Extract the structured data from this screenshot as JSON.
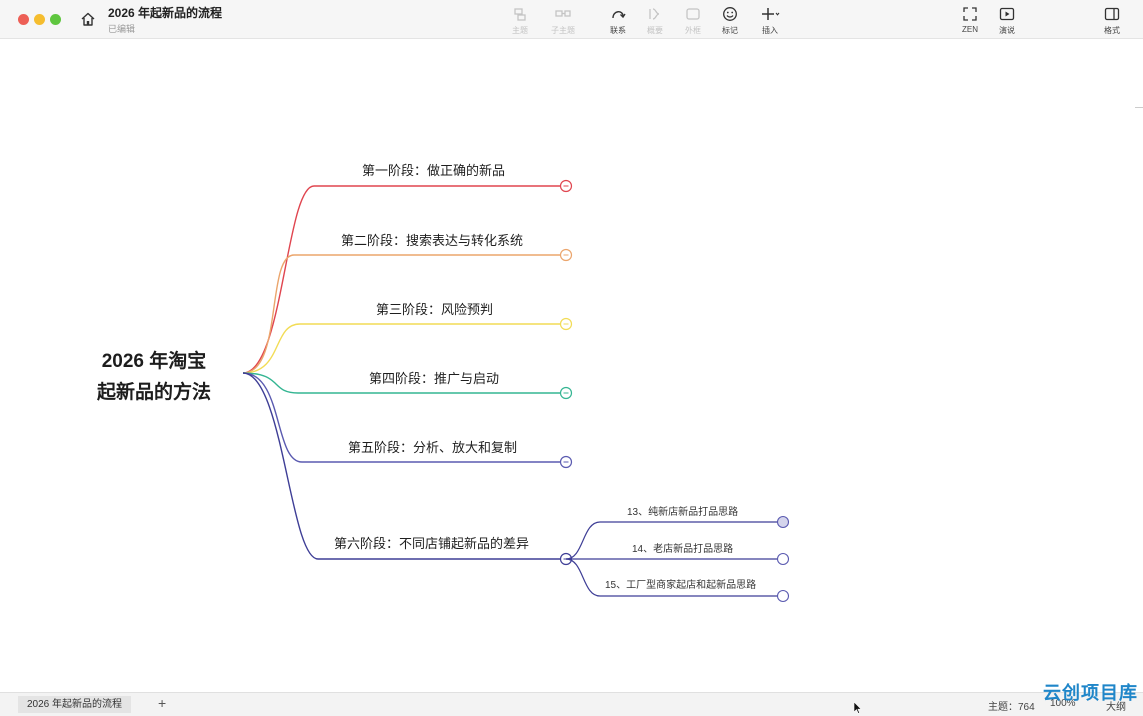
{
  "window": {
    "title": "2026 年起新品的流程",
    "status": "已编辑"
  },
  "toolbar": {
    "buttons": [
      {
        "label": "主题",
        "icon": "topic-icon",
        "enabled": false
      },
      {
        "label": "子主题",
        "icon": "subtopic-icon",
        "enabled": false
      },
      {
        "label": "联系",
        "icon": "relationship-icon",
        "enabled": true
      },
      {
        "label": "概要",
        "icon": "summary-icon",
        "enabled": false
      },
      {
        "label": "外框",
        "icon": "boundary-icon",
        "enabled": false
      },
      {
        "label": "标记",
        "icon": "marker-icon",
        "enabled": true
      },
      {
        "label": "插入",
        "icon": "insert-icon",
        "enabled": true
      },
      {
        "label": "ZEN",
        "icon": "zen-icon",
        "enabled": true
      },
      {
        "label": "演说",
        "icon": "pitch-icon",
        "enabled": true
      },
      {
        "label": "格式",
        "icon": "format-panel-icon",
        "enabled": true
      }
    ]
  },
  "mindmap": {
    "root": [
      "2026 年淘宝",
      "起新品的方法"
    ],
    "branches": [
      {
        "label": "第一阶段：做正确的新品",
        "color": "#e0454f"
      },
      {
        "label": "第二阶段：搜索表达与转化系统",
        "color": "#eba56c"
      },
      {
        "label": "第三阶段：风险预判",
        "color": "#f2dc55"
      },
      {
        "label": "第四阶段：推广与启动",
        "color": "#34b592"
      },
      {
        "label": "第五阶段：分析、放大和复制",
        "color": "#5a5ab0"
      },
      {
        "label": "第六阶段：不同店铺起新品的差异",
        "color": "#3e3e96",
        "children": [
          "13、纯新店新品打品思路",
          "14、老店新品打品思路",
          "15、工厂型商家起店和起新品思路"
        ]
      }
    ]
  },
  "footer": {
    "sheet_tab": "2026 年起新品的流程",
    "add_sheet": "+",
    "topic_count": "主题：764",
    "zoom": "100%",
    "outline": "大纲"
  },
  "watermark": "云创项目库"
}
